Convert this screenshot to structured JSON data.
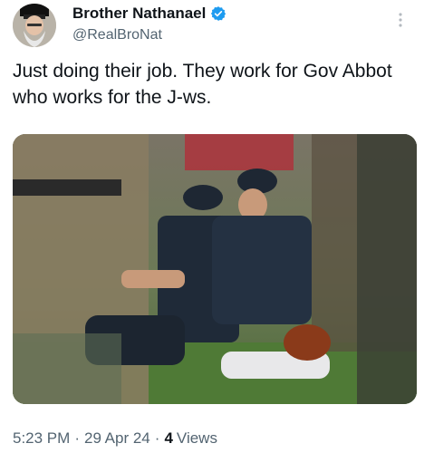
{
  "author": {
    "display_name": "Brother Nathanael",
    "handle": "@RealBroNat",
    "verified_icon": "verified-badge-icon",
    "badge_color": "#1d9bf0"
  },
  "tweet": {
    "text": "Just doing their job. They work for Gov Abbot who works for the J-ws."
  },
  "meta": {
    "time": "5:23 PM",
    "separator": "·",
    "date": "29 Apr 24",
    "views_count": "4",
    "views_label": "Views"
  }
}
